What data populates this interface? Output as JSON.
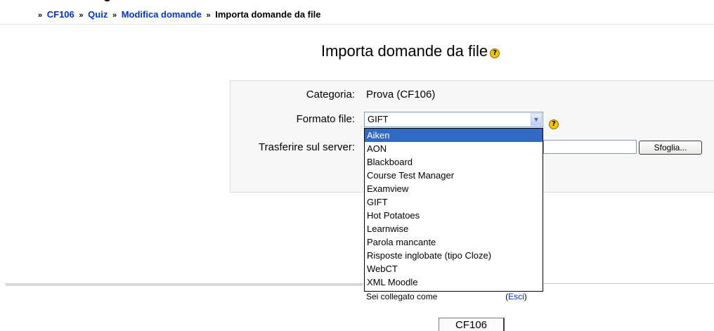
{
  "breadcrumb": {
    "separator": "»",
    "items": [
      {
        "label": "CF106",
        "link": true
      },
      {
        "label": "Quiz",
        "link": true
      },
      {
        "label": "Modifica domande",
        "link": true
      },
      {
        "label": "Importa domande da file",
        "link": false
      }
    ]
  },
  "page": {
    "title": "Importa domande da file",
    "help_icon": "help-icon",
    "help_symbol": "?"
  },
  "form": {
    "category_label": "Categoria:",
    "category_value": "Prova (CF106)",
    "format_label": "Formato file:",
    "format_selected": "GIFT",
    "upload_label": "Trasferire sul server:",
    "browse_label": "Sfoglia...",
    "format_options": [
      "Aiken",
      "AON",
      "Blackboard",
      "Course Test Manager",
      "Examview",
      "GIFT",
      "Hot Potatoes",
      "Learnwise",
      "Parola mancante",
      "Risposte inglobate (tipo Cloze)",
      "WebCT",
      "XML Moodle"
    ],
    "highlighted_option": "Aiken"
  },
  "footer": {
    "logged_in_prefix": "Sei collegato come",
    "logout_open": "(",
    "logout_label": "Esci",
    "logout_close": ")",
    "course_button": "CF106"
  },
  "colors": {
    "link": "#0033cc",
    "selected_bg": "#316ac5",
    "form_bg": "#f7f7f7"
  }
}
